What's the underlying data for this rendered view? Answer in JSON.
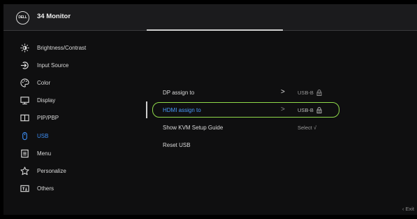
{
  "header": {
    "logo": "DELL",
    "title": "34 Monitor"
  },
  "sidebar": {
    "items": [
      {
        "label": "Brightness/Contrast",
        "icon": "brightness-icon"
      },
      {
        "label": "Input Source",
        "icon": "input-source-icon"
      },
      {
        "label": "Color",
        "icon": "color-palette-icon"
      },
      {
        "label": "Display",
        "icon": "display-icon"
      },
      {
        "label": "PIP/PBP",
        "icon": "pip-pbp-icon"
      },
      {
        "label": "USB",
        "icon": "usb-mouse-icon",
        "active": true
      },
      {
        "label": "Menu",
        "icon": "menu-icon"
      },
      {
        "label": "Personalize",
        "icon": "star-icon"
      },
      {
        "label": "Others",
        "icon": "others-icon"
      }
    ]
  },
  "main": {
    "rows": [
      {
        "label": "DP assign to",
        "chevron": ">",
        "value": "USB-B"
      },
      {
        "label": "HDMI assign to",
        "chevron": ">",
        "value": "USB-B",
        "selected": true
      },
      {
        "label": "Show KVM Setup Guide",
        "chevron": "",
        "value": "Select √"
      },
      {
        "label": "Reset USB",
        "chevron": "",
        "value": ""
      }
    ]
  },
  "footer": {
    "exit": "‹  Exit"
  },
  "colors": {
    "active_blue": "#3e8ef4",
    "selection_green": "#8fd94a",
    "background": "#0f0f10",
    "header": "#1b1b1d"
  }
}
